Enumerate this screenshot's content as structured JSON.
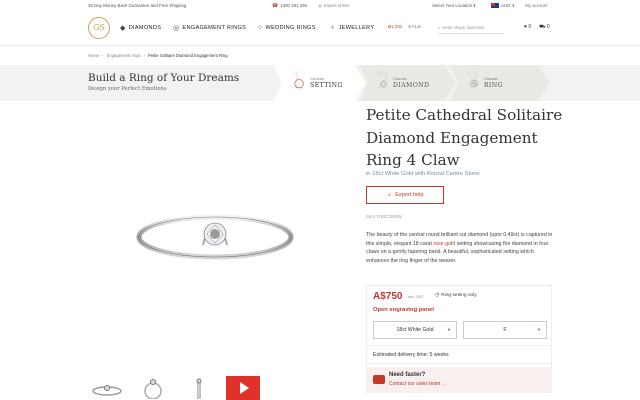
{
  "topbar": {
    "promo": "30 Day Money Back Guarantee and Free Shipping",
    "phone": "1300 181 294",
    "online": "Expert online",
    "location": "Select Your Location",
    "currency": "AUD",
    "account": "My account"
  },
  "nav": {
    "logo": "GS",
    "items": [
      "DIAMONDS",
      "ENGAGEMENT RINGS",
      "WEDDING RINGS",
      "JEWELLERY"
    ],
    "blog": "BLOG",
    "sale": "SALE",
    "search_placeholder": "Heart shape diamonds",
    "wishlist_count": "0",
    "cart_count": "0"
  },
  "breadcrumb": [
    "Home",
    "Engagement rings",
    "Petite Solitaire Diamond Engagement Ring"
  ],
  "builder": {
    "title": "Build a Ring of Your Dreams",
    "subtitle": "Design your Perfect Emotions",
    "steps": [
      {
        "num": "1",
        "small": "Choose",
        "label": "SETTING"
      },
      {
        "num": "2",
        "small": "Choose",
        "label": "DIAMOND"
      },
      {
        "num": "3",
        "small": "Choose",
        "label": "RING"
      }
    ]
  },
  "product": {
    "title": "Petite Cathedral Solitaire Diamond Engagement Ring 4 Claw",
    "subtitle": "in 18ct White Gold with Round Centre Stone",
    "expert_help": "Expert help",
    "sku": "SKU GSEC093W",
    "desc_before": "The beauty of the central round brilliant cut diamond (upto 0.49ct) is captured in this simple, elegant 18 carat ",
    "desc_link": "rose gold",
    "desc_after": " setting showcasing the diamond in four claws on a gently tapering band. A beautiful, sophisticated setting which enhances the ring finger of the wearer.",
    "price": "A$750",
    "gst": "incl. GST",
    "ring_only": "Ring setting only",
    "engraving": "Open engraving panel",
    "metal": "18ct White Gold",
    "size": "F",
    "delivery": "Estimated delivery time: 5 weeks",
    "need_faster": "Need faster?",
    "contact": "Contact our sales team →"
  },
  "colors": {
    "accent": "#c0392b",
    "gold": "#c8a15a"
  }
}
